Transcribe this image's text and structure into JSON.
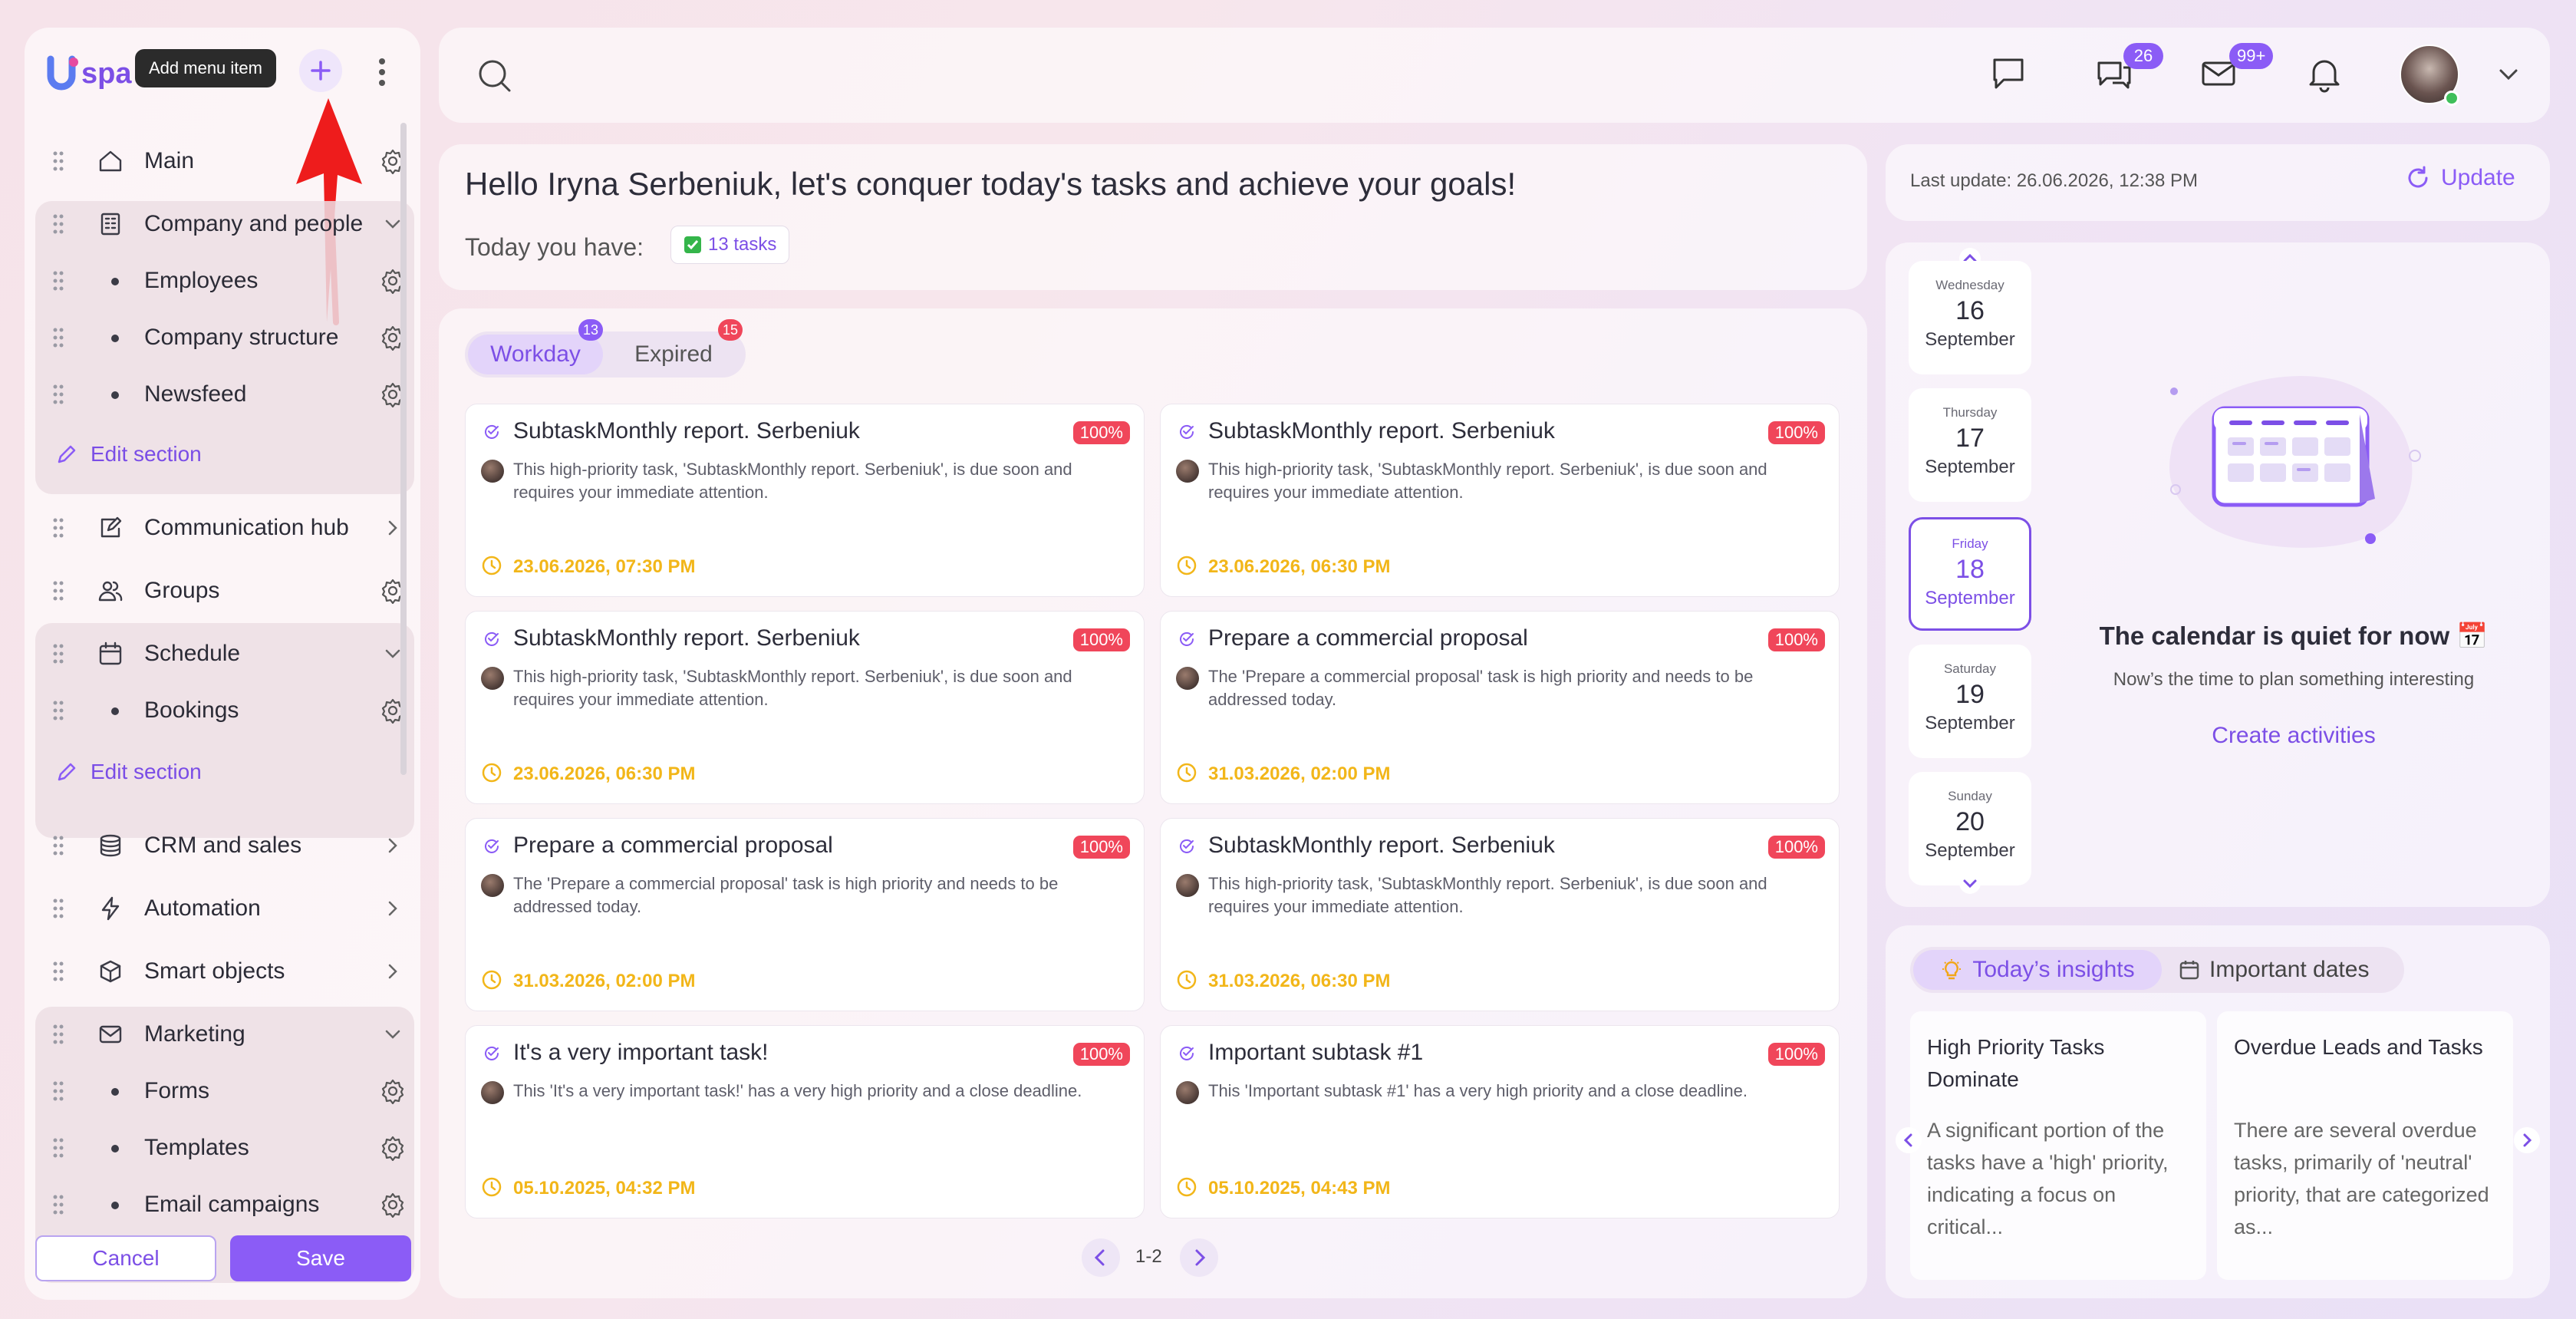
{
  "sidebar": {
    "logo_text": "spa",
    "tooltip": "Add menu item",
    "items": [
      {
        "label": "Main",
        "icon": "home-icon"
      },
      {
        "label": "Company and people",
        "icon": "building-icon"
      },
      {
        "label": "Employees"
      },
      {
        "label": "Company structure"
      },
      {
        "label": "Newsfeed"
      },
      {
        "label": "Communication hub",
        "icon": "chat-edit-icon"
      },
      {
        "label": "Groups",
        "icon": "users-icon"
      },
      {
        "label": "Schedule",
        "icon": "calendar-icon"
      },
      {
        "label": "Bookings"
      },
      {
        "label": "CRM and sales",
        "icon": "database-icon"
      },
      {
        "label": "Automation",
        "icon": "bolt-icon"
      },
      {
        "label": "Smart objects",
        "icon": "smart-object-icon"
      },
      {
        "label": "Marketing",
        "icon": "mail-icon"
      },
      {
        "label": "Forms"
      },
      {
        "label": "Templates"
      },
      {
        "label": "Email campaigns"
      }
    ],
    "edit_section": "Edit section",
    "cancel_label": "Cancel",
    "save_label": "Save"
  },
  "header": {
    "chat_badge": "26",
    "mail_badge": "99+"
  },
  "greeting": {
    "title": "Hello Iryna Serbeniuk, let's conquer today's tasks and achieve your goals!",
    "today_label": "Today you have:",
    "tasks_chip": "13 tasks"
  },
  "tasks": {
    "tabs": [
      {
        "label": "Workday",
        "count": "13"
      },
      {
        "label": "Expired",
        "count": "15"
      }
    ],
    "cards": [
      {
        "title": "SubtaskMonthly report. Serbeniuk",
        "percent": "100%",
        "desc": "This high-priority task, 'SubtaskMonthly report. Serbeniuk', is due soon and requires your immediate attention.",
        "date": "23.06.2026, 07:30 PM"
      },
      {
        "title": "SubtaskMonthly report. Serbeniuk",
        "percent": "100%",
        "desc": "This high-priority task, 'SubtaskMonthly report. Serbeniuk', is due soon and requires your immediate attention.",
        "date": "23.06.2026, 06:30 PM"
      },
      {
        "title": "SubtaskMonthly report. Serbeniuk",
        "percent": "100%",
        "desc": "This high-priority task, 'SubtaskMonthly report. Serbeniuk', is due soon and requires your immediate attention.",
        "date": "23.06.2026, 06:30 PM"
      },
      {
        "title": "Prepare a commercial proposal",
        "percent": "100%",
        "desc": "The 'Prepare a commercial proposal' task is high priority and needs to be addressed today.",
        "date": "31.03.2026, 02:00 PM"
      },
      {
        "title": "Prepare a commercial proposal",
        "percent": "100%",
        "desc": "The 'Prepare a commercial proposal' task is high priority and needs to be addressed today.",
        "date": "31.03.2026, 02:00 PM"
      },
      {
        "title": "SubtaskMonthly report. Serbeniuk",
        "percent": "100%",
        "desc": "This high-priority task, 'SubtaskMonthly report. Serbeniuk', is due soon and requires your immediate attention.",
        "date": "31.03.2026, 06:30 PM"
      },
      {
        "title": "It's a very important task!",
        "percent": "100%",
        "desc": "This 'It's a very important task!' has a very high priority and a close deadline.",
        "date": "05.10.2025, 04:32 PM"
      },
      {
        "title": "Important subtask #1",
        "percent": "100%",
        "desc": "This 'Important subtask #1' has a very high priority and a close deadline.",
        "date": "05.10.2025, 04:43 PM"
      }
    ],
    "pagination": "1-2"
  },
  "update": {
    "last_update": "Last update: 26.06.2026, 12:38 PM",
    "button": "Update"
  },
  "calendar": {
    "days": [
      {
        "weekday": "Wednesday",
        "num": "16",
        "month": "September"
      },
      {
        "weekday": "Thursday",
        "num": "17",
        "month": "September"
      },
      {
        "weekday": "Friday",
        "num": "18",
        "month": "September"
      },
      {
        "weekday": "Saturday",
        "num": "19",
        "month": "September"
      },
      {
        "weekday": "Sunday",
        "num": "20",
        "month": "September"
      }
    ],
    "empty_title": "The calendar is quiet for now 📅",
    "empty_sub": "Now’s the time to plan something interesting",
    "create_link": "Create activities"
  },
  "insights": {
    "tabs": [
      "Today’s insights",
      "Important dates"
    ],
    "cards": [
      {
        "title": "High Priority Tasks Dominate",
        "text": "A significant portion of the tasks have a 'high' priority, indicating a focus on critical..."
      },
      {
        "title": "Overdue Leads and Tasks",
        "text": "There are several overdue tasks, primarily of 'neutral' priority, that are categorized as..."
      }
    ]
  },
  "colors": {
    "accent": "#8b5cf6",
    "danger": "#f0465a",
    "date": "#f2b619"
  }
}
